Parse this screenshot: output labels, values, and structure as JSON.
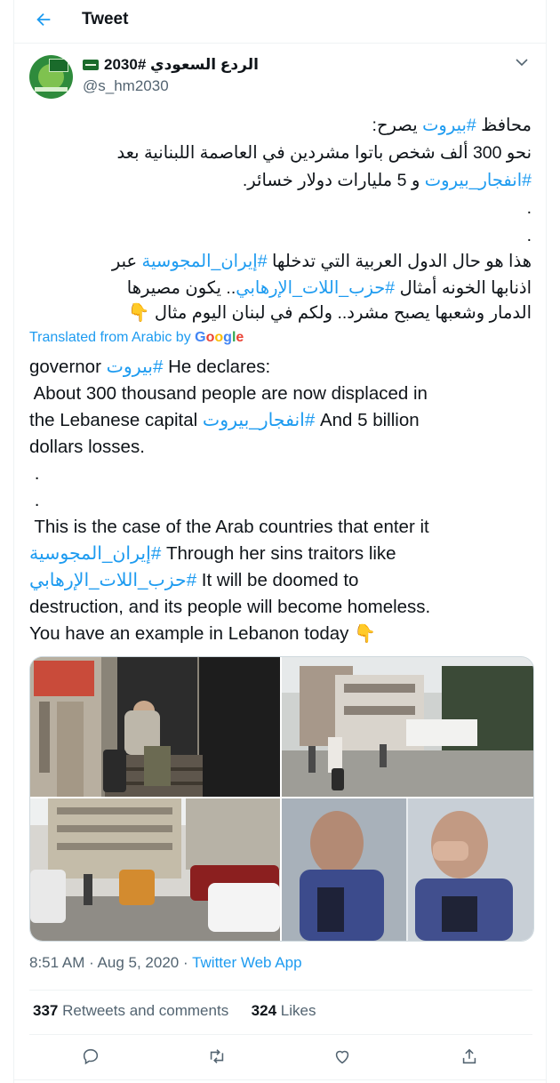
{
  "header": {
    "back_icon": "arrow-left-icon",
    "title": "Tweet"
  },
  "author": {
    "name": "الردع السعودي #2030",
    "handle": "@s_hm2030",
    "flag_icon": "saudi-flag-emoji"
  },
  "arabic": {
    "line1_pre": "محافظ ",
    "line1_tag": "#بيروت",
    "line1_post": " يصرح:",
    "line2": "نحو 300 ألف شخص باتوا مشردين في العاصمة اللبنانية بعد",
    "line3_tag": "#انفجار_بيروت",
    "line3_post": " و 5 مليارات دولار خسائر.",
    "dot1": ".",
    "dot2": ".",
    "line6_pre": "هذا هو حال الدول العربية التي تدخلها ",
    "line6_tag": "#إيران_المجوسية",
    "line6_post": " عبر",
    "line7_pre": "اذنابها الخونه أمثال ",
    "line7_tag": "#حزب_اللات_الإرهابي",
    "line7_post": ".. يكون مصيرها",
    "line8": "الدمار وشعبها يصبح مشرد.. ولكم في لبنان اليوم مثال",
    "line8_emoji": "👇"
  },
  "translation": {
    "label": "Translated from Arabic by",
    "brand": [
      "G",
      "o",
      "o",
      "g",
      "l",
      "e"
    ]
  },
  "english": {
    "l1_pre": "governor ",
    "l1_tag": "بيروت#",
    "l1_post": " He declares:",
    "l2": " About 300 thousand people are now displaced in",
    "l3_pre": "the Lebanese capital ",
    "l3_tag": "انفجار_بيروت#",
    "l3_post": " And 5 billion",
    "l4": "dollars losses.",
    "l5": " .",
    "l6": " .",
    "l7": " This is the case of the Arab countries that enter it",
    "l8_tag": "إيران_المجوسية#",
    "l8_post": " Through her sins traitors like",
    "l9_tag": "حزب_اللات_الإرهابي#",
    "l9_post": " It will be doomed to",
    "l10": "destruction, and its people will become homeless.",
    "l11": "You have an example in Lebanon today ",
    "l11_emoji": "👇"
  },
  "media": {
    "photos": [
      "man-with-luggage-at-doorway",
      "damaged-street-people-walking",
      "street-traffic-damaged-buildings",
      "governor-crying-at-microphones"
    ]
  },
  "meta": {
    "time": "8:51 AM",
    "dot": " · ",
    "date": "Aug 5, 2020",
    "app": "Twitter Web App"
  },
  "stats": {
    "retweets": "337",
    "retweets_label": "Retweets and comments",
    "likes": "324",
    "likes_label": "Likes"
  },
  "actions": [
    "reply-icon",
    "retweet-icon",
    "like-icon",
    "share-icon"
  ]
}
